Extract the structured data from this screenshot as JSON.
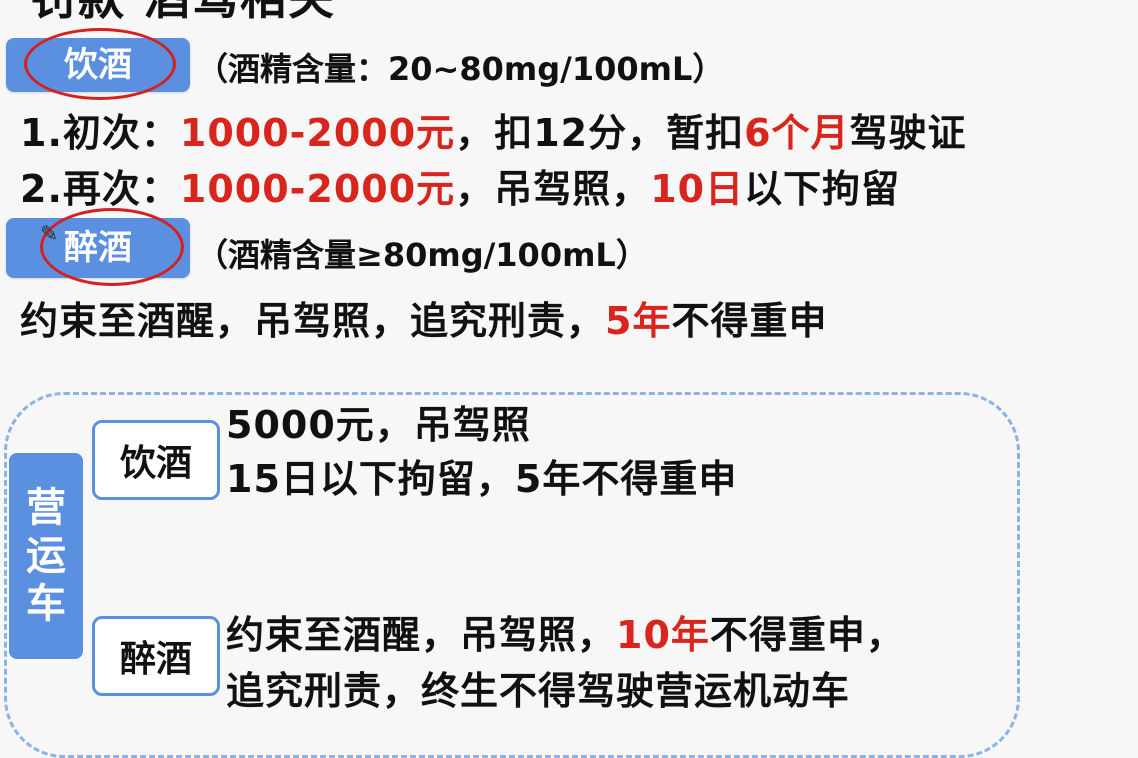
{
  "title": "罚款 酒驾相关",
  "drink": {
    "tag": "饮酒",
    "note": "（酒精含量：20~80mg/100mL）",
    "line1": {
      "prefix": "1.初次：",
      "fine": "1000-2000元",
      "mid": "，扣12分，暂扣",
      "period": "6个月",
      "suffix": "驾驶证"
    },
    "line2": {
      "prefix": "2.再次：",
      "fine": "1000-2000元",
      "mid": "，吊驾照，",
      "days": "10日",
      "suffix": "以下拘留"
    }
  },
  "drunk": {
    "tag": "醉酒",
    "note": "（酒精含量≥80mg/100mL）",
    "line": {
      "prefix": "约束至酒醒，吊驾照，追究刑责，",
      "years": "5年",
      "suffix": "不得重申"
    }
  },
  "commercial": {
    "side_chars": [
      "营",
      "运",
      "车"
    ],
    "drink_tag": "饮酒",
    "drink_line1": "5000元，吊驾照",
    "drink_line2": "15日以下拘留，5年不得重申",
    "drunk_tag": "醉酒",
    "drunk_line1": {
      "prefix": "约束至酒醒，吊驾照，",
      "years": "10年",
      "suffix": "不得重申，"
    },
    "drunk_line2": "追究刑责，终生不得驾驶营运机动车"
  },
  "colors": {
    "accent_blue": "#5b8fe0",
    "highlight_red": "#d8251d",
    "annotation_red": "#d62020",
    "dash_blue": "#8bb3e6"
  },
  "icons": [
    "pencil-cursor-icon"
  ]
}
